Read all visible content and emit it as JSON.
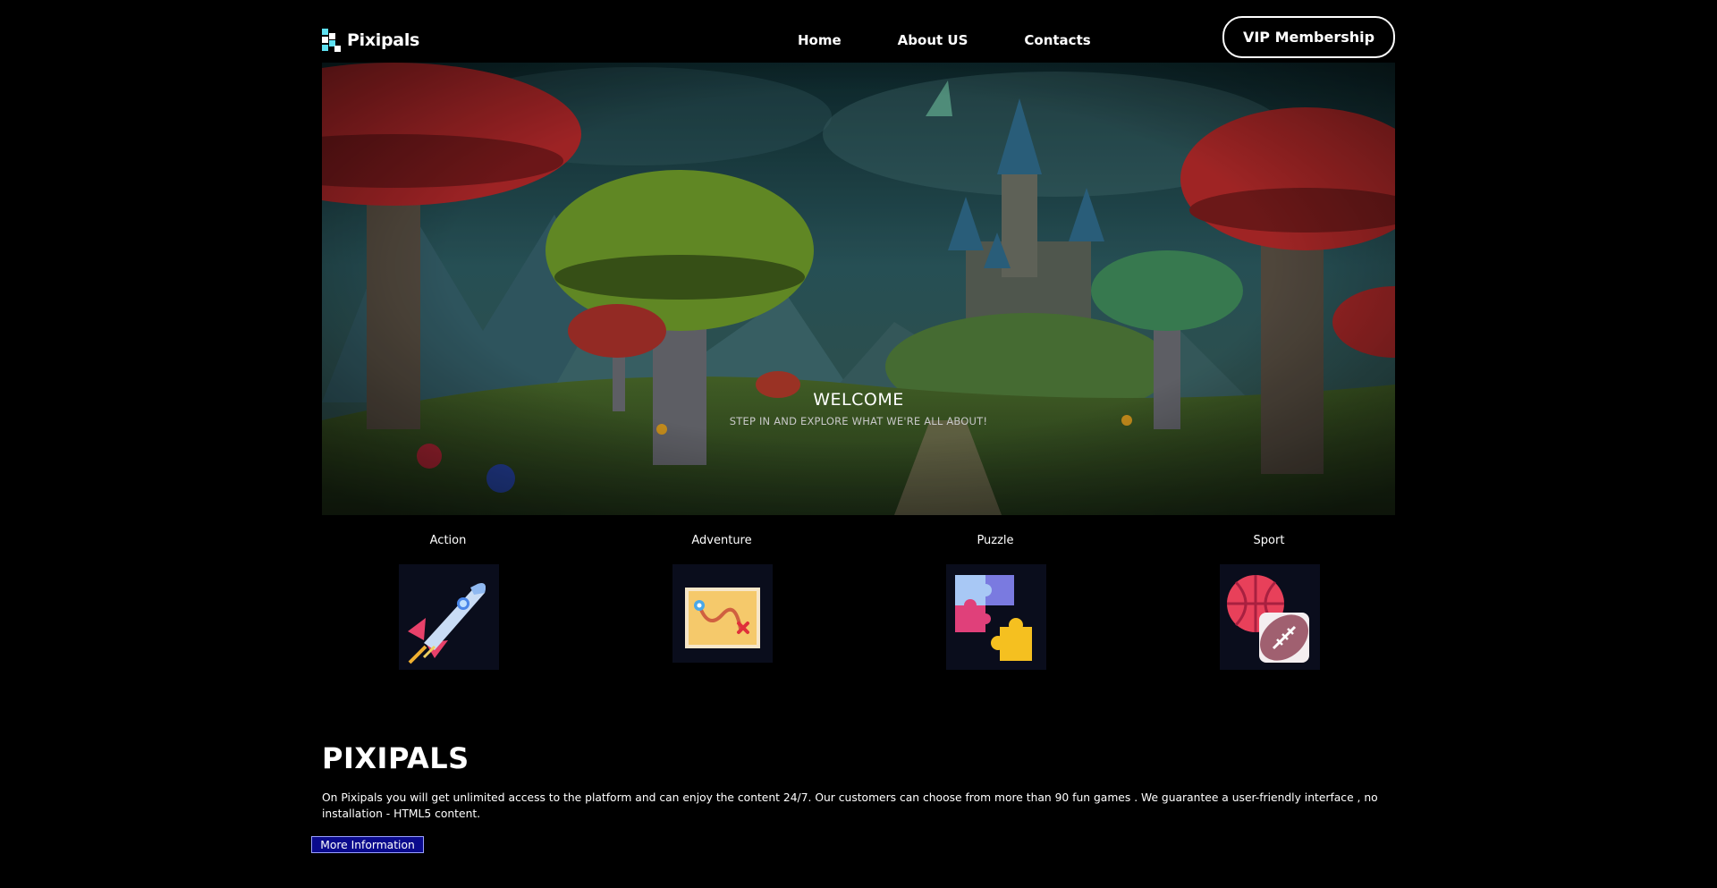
{
  "header": {
    "logo_text": "Pixipals",
    "nav": [
      {
        "label": "Home"
      },
      {
        "label": "About US"
      },
      {
        "label": "Contacts"
      }
    ],
    "vip_label": "VIP Membership"
  },
  "hero": {
    "title": "WELCOME",
    "subtitle": "STEP IN AND EXPLORE WHAT WE'RE ALL ABOUT!"
  },
  "categories": [
    {
      "label": "Action",
      "icon": "rocket-icon"
    },
    {
      "label": "Adventure",
      "icon": "treasure-map-icon"
    },
    {
      "label": "Puzzle",
      "icon": "puzzle-pieces-icon"
    },
    {
      "label": "Sport",
      "icon": "sport-balls-icon"
    }
  ],
  "about": {
    "title": "PIXIPALS",
    "text": "On Pixipals you will get unlimited access to the platform and can enjoy the content 24/7. Our customers can choose from more than 90 fun games . We guarantee a user-friendly interface , no installation - HTML5 content.",
    "button_label": "More Information"
  },
  "colors": {
    "background": "#000000",
    "logo_accent": "#5ee0f0",
    "button_blue": "#0a0a8c"
  }
}
